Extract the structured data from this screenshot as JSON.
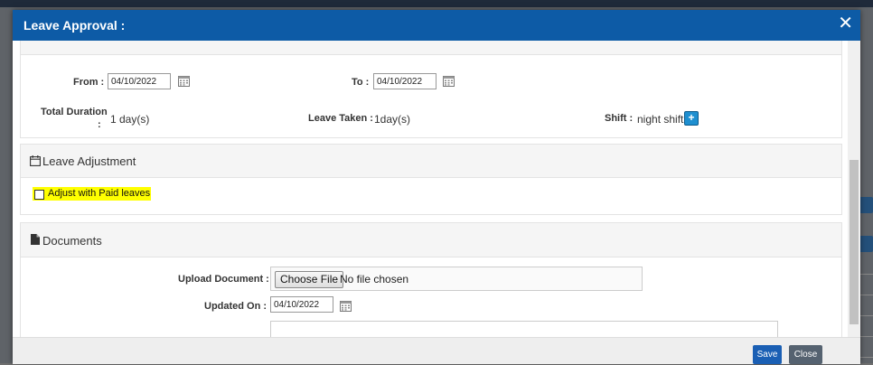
{
  "modal": {
    "title": "Leave Approval :",
    "close_glyph": "✕"
  },
  "details": {
    "from_label": "From :",
    "from_value": "04/10/2022",
    "to_label": "To :",
    "to_value": "04/10/2022",
    "total_duration_label": "Total Duration",
    "total_duration_colon": ":",
    "total_duration_value": "1 day(s)",
    "leave_taken_label": "Leave Taken :",
    "leave_taken_value": "1day(s)",
    "shift_label": "Shift :",
    "shift_value": "night shift",
    "plus_glyph": "+"
  },
  "leave_adjustment": {
    "title": "Leave Adjustment",
    "checkbox_label": "Adjust with Paid leaves",
    "checked": false
  },
  "documents": {
    "title": "Documents",
    "upload_label": "Upload Document :",
    "choose_file_label": "Choose File",
    "file_status": "No file chosen",
    "updated_on_label": "Updated On :",
    "updated_on_value": "04/10/2022"
  },
  "footer": {
    "save_label": "Save",
    "close_label": "Close"
  },
  "colors": {
    "header_bg": "#0d5ba6",
    "save_bg": "#1a5fb4",
    "close_bg": "#556270",
    "highlight": "#ffff00"
  }
}
